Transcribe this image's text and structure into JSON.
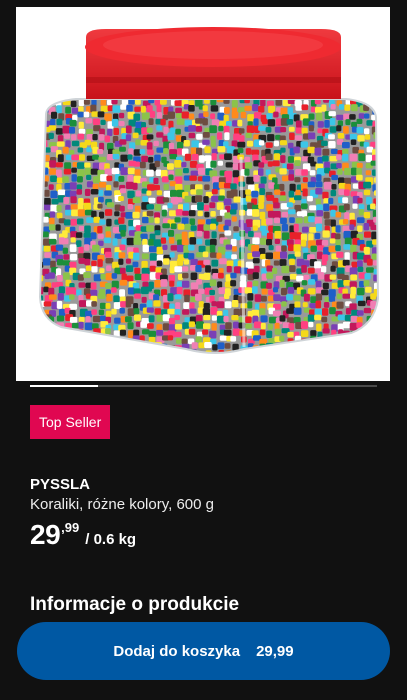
{
  "product": {
    "badge": "Top Seller",
    "name": "PYSSLA",
    "description": "Koraliki, różne kolory, 600 g",
    "price_integer": "29",
    "price_decimal": ",99",
    "price_unit": "/ 0.6 kg"
  },
  "section": {
    "title": "Informacje o produkcie"
  },
  "cart_button": {
    "label": "Dodaj do koszyka",
    "price": "29,99"
  },
  "colors": {
    "background": "#111111",
    "badge": "#e00751",
    "button": "#0058a3",
    "lid": "#e61920"
  },
  "image": {
    "icon": "bead-jar-product-photo"
  }
}
